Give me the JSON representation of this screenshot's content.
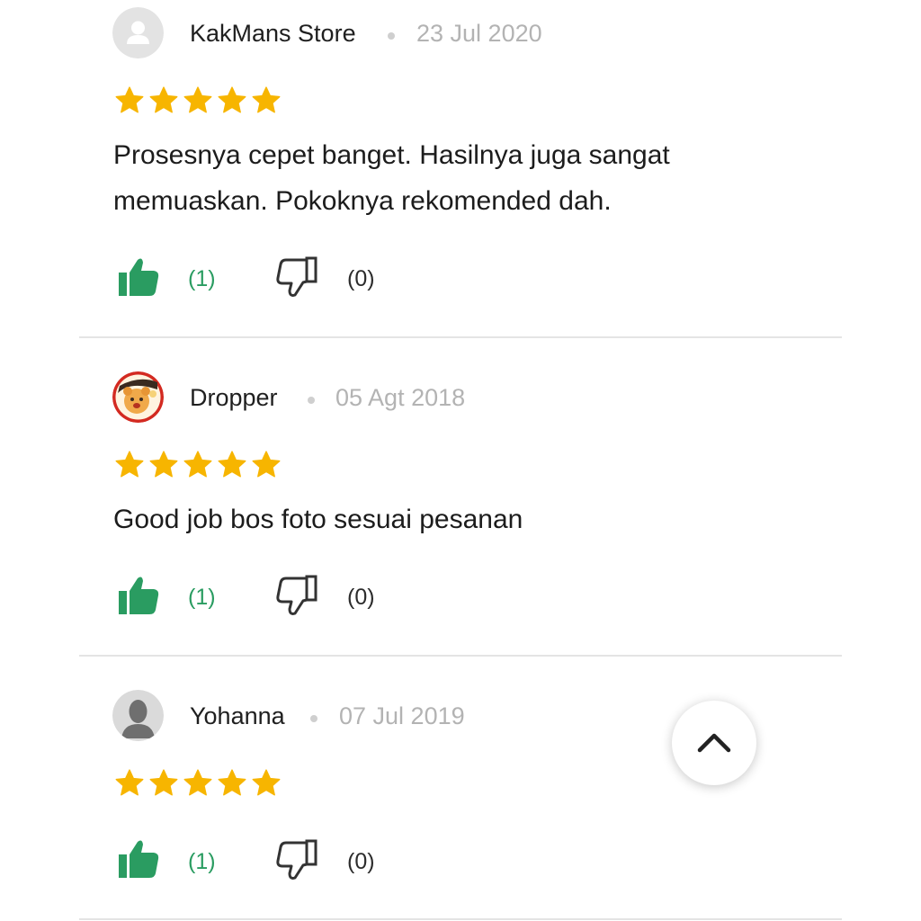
{
  "reviews": [
    {
      "username": "KakMans Store",
      "date": "23 Jul 2020",
      "rating": 5,
      "text": "Prosesnya cepet banget. Hasilnya juga sangat memuaskan. Pokoknya rekomended dah.",
      "likes": "(1)",
      "dislikes": "(0)",
      "avatar": "default-user-icon"
    },
    {
      "username": "Dropper",
      "date": "05 Agt 2018",
      "rating": 5,
      "text": "Good job bos foto sesuai pesanan",
      "likes": "(1)",
      "dislikes": "(0)",
      "avatar": "character-avatar"
    },
    {
      "username": "Yohanna",
      "date": "07 Jul 2019",
      "rating": 5,
      "text": "",
      "likes": "(1)",
      "dislikes": "(0)",
      "avatar": "silhouette-avatar"
    }
  ],
  "icons": {
    "star": "star-icon",
    "like": "thumbs-up-icon",
    "dislike": "thumbs-down-icon",
    "scroll_top": "chevron-up-icon"
  },
  "colors": {
    "star": "#F7B500",
    "like": "#2A9C61",
    "dislike_outline": "#333333",
    "date": "#B3B3B3",
    "divider": "#E4E4E4"
  }
}
